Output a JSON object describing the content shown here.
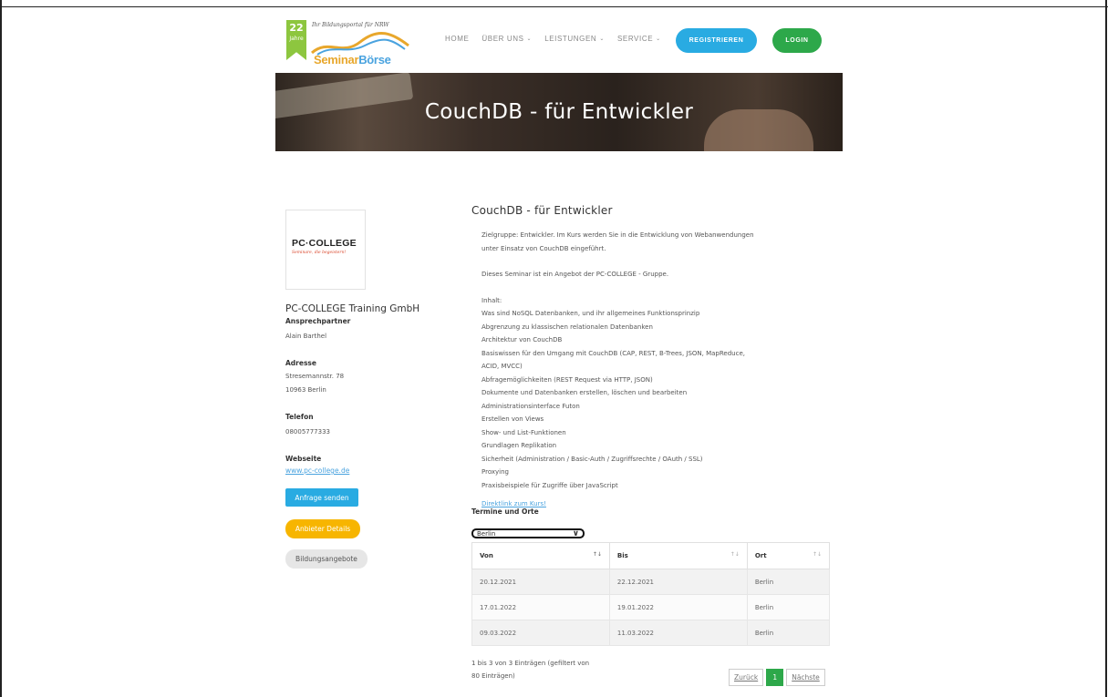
{
  "logo": {
    "badge_number": "22",
    "badge_word": "Jahre",
    "tagline": "Ihr Bildungsportal für NRW",
    "name_part1": "Seminar",
    "name_part2": "Börse"
  },
  "nav": {
    "items": [
      {
        "label": "HOME",
        "caret": false
      },
      {
        "label": "ÜBER UNS",
        "caret": true
      },
      {
        "label": "LEISTUNGEN",
        "caret": true
      },
      {
        "label": "SERVICE",
        "caret": true
      }
    ],
    "register_label": "REGISTRIEREN",
    "login_label": "LOGIN"
  },
  "hero": {
    "title": "CouchDB - für Entwickler"
  },
  "provider": {
    "logo_main": "PC·COLLEGE",
    "logo_sub": "Seminare, die begeistern!",
    "name": "PC-COLLEGE Training GmbH",
    "contact_label": "Ansprechpartner",
    "contact_value": "Alain Barthel",
    "address_label": "Adresse",
    "address_line1": "Stresemannstr. 78",
    "address_line2": "10963 Berlin",
    "phone_label": "Telefon",
    "phone_value": "08005777333",
    "website_label": "Webseite",
    "website_value": "www.pc-college.de",
    "btn_request": "Anfrage senden",
    "btn_details": "Anbieter Details",
    "btn_offers": "Bildungsangebote"
  },
  "course": {
    "title": "CouchDB - für Entwickler",
    "target_line1": "Zielgruppe: Entwickler. Im Kurs werden Sie in die Entwicklung von Webanwendungen",
    "target_line2": "unter Einsatz von CouchDB eingeführt.",
    "offer_line": "Dieses Seminar ist ein Angebot der PC-COLLEGE - Gruppe.",
    "content_label": "Inhalt:",
    "content_items": [
      "Was sind NoSQL Datenbanken, und ihr allgemeines Funktionsprinzip",
      "Abgrenzung zu klassischen relationalen Datenbanken",
      "Architektur von CouchDB",
      "Basiswissen für den Umgang mit CouchDB (CAP, REST, B-Trees, JSON, MapReduce,",
      "ACID, MVCC)",
      "Abfragemöglichkeiten (REST Request via HTTP, JSON)",
      "Dokumente und Datenbanken erstellen, löschen und bearbeiten",
      "Administrationsinterface Futon",
      "Erstellen von Views",
      "Show- und List-Funktionen",
      "Grundlagen Replikation",
      "Sicherheit (Administration / Basic-Auth / Zugriffsrechte / OAuth / SSL)",
      "Proxying",
      "Praxisbeispiele für Zugriffe über JavaScript"
    ],
    "direct_link": "Direktlink zum Kurs!",
    "dates_heading": "Termine und Orte",
    "location_select": "Berlin"
  },
  "table": {
    "headers": [
      "Von",
      "Bis",
      "Ort"
    ],
    "rows": [
      [
        "20.12.2021",
        "22.12.2021",
        "Berlin"
      ],
      [
        "17.01.2022",
        "19.01.2022",
        "Berlin"
      ],
      [
        "09.03.2022",
        "11.03.2022",
        "Berlin"
      ]
    ],
    "info_line1": "1 bis 3 von 3 Einträgen (gefiltert von",
    "info_line2": "80 Einträgen)",
    "prev": "Zurück",
    "page": "1",
    "next": "Nächste"
  }
}
